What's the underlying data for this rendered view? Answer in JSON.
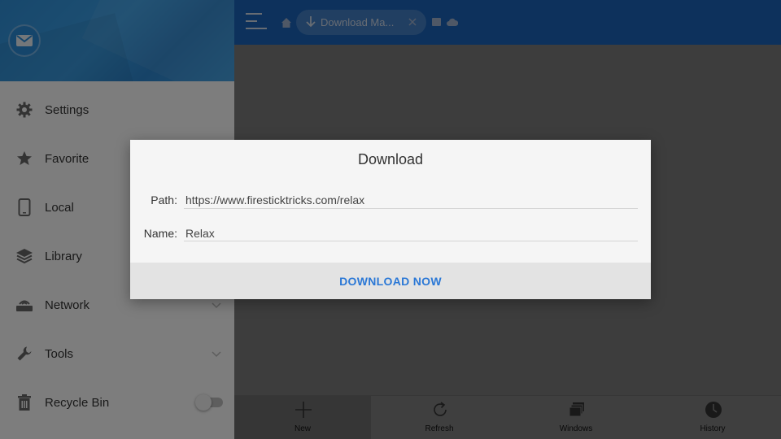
{
  "sidebar": {
    "items": [
      {
        "label": "Settings",
        "icon": "gear-icon"
      },
      {
        "label": "Favorite",
        "icon": "star-icon"
      },
      {
        "label": "Local",
        "icon": "phone-icon"
      },
      {
        "label": "Library",
        "icon": "layers-icon"
      },
      {
        "label": "Network",
        "icon": "router-icon"
      },
      {
        "label": "Tools",
        "icon": "wrench-icon"
      },
      {
        "label": "Recycle Bin",
        "icon": "trash-icon"
      }
    ]
  },
  "topbar": {
    "tab_label": "Download Ma..."
  },
  "bottombar": {
    "items": [
      {
        "label": "New",
        "icon": "plus-icon"
      },
      {
        "label": "Refresh",
        "icon": "refresh-icon"
      },
      {
        "label": "Windows",
        "icon": "windows-icon"
      },
      {
        "label": "History",
        "icon": "clock-icon"
      }
    ]
  },
  "dialog": {
    "title": "Download",
    "path_label": "Path:",
    "path_value": "https://www.firesticktricks.com/relax",
    "name_label": "Name:",
    "name_value": "Relax",
    "button_label": "DOWNLOAD NOW"
  },
  "colors": {
    "accent": "#1a62b8",
    "button_text": "#2b78d6"
  }
}
